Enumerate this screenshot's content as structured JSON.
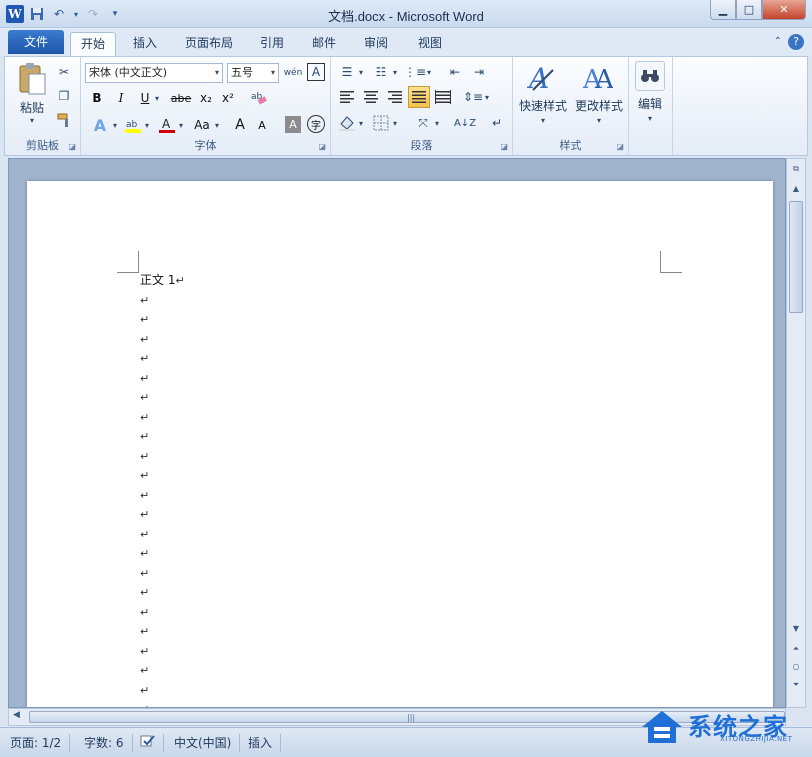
{
  "window": {
    "title": "文档.docx - Microsoft Word"
  },
  "qat": {
    "logo": "W",
    "undo": "↶",
    "redo": "↷",
    "customize": "▾"
  },
  "tabs": {
    "file": "文件",
    "items": [
      "开始",
      "插入",
      "页面布局",
      "引用",
      "邮件",
      "审阅",
      "视图"
    ],
    "active": "开始"
  },
  "ribbon": {
    "clipboard": {
      "label": "剪贴板",
      "paste": "粘贴"
    },
    "font": {
      "label": "字体",
      "font_name": "宋体 (中文正文)",
      "font_size": "五号",
      "bold": "B",
      "italic": "I",
      "underline": "U",
      "strikethrough": "abe",
      "subscript": "x₂",
      "superscript": "x²",
      "case": "Aa",
      "grow": "A",
      "shrink": "A",
      "phonetic": "wén",
      "border_char": "A",
      "shade_char": "A",
      "enclose": "字"
    },
    "paragraph": {
      "label": "段落"
    },
    "styles": {
      "label": "样式",
      "quick_styles": "快速样式",
      "change_styles": "更改样式"
    },
    "editing": {
      "label": "编辑"
    }
  },
  "document": {
    "first_line": "正文 1",
    "paragraph_mark": "↵",
    "empty_paragraphs": 22
  },
  "statusbar": {
    "page": "页面: 1/2",
    "words": "字数: 6",
    "language": "中文(中国)",
    "mode": "插入"
  },
  "watermark": {
    "brand": "系统之家",
    "site": "XITONGZHIJIA.NET"
  },
  "colors": {
    "file_tab": "#1d56a8",
    "highlight": "#ffff00",
    "font_color": "#d00000",
    "page_bg": "#ffffff"
  }
}
